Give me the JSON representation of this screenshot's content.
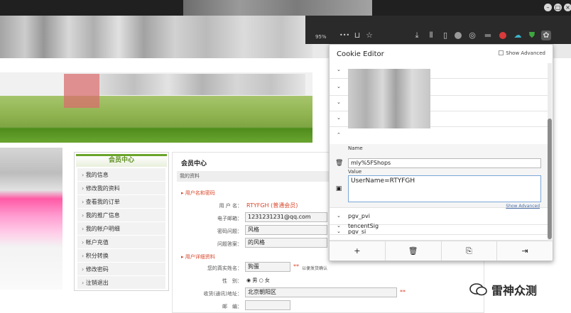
{
  "browser": {
    "zoom": "95%",
    "overflow_label": "•••"
  },
  "member": {
    "header": "会员中心",
    "items": [
      "我的信息",
      "修改我的资料",
      "查看我的订单",
      "我的推广信息",
      "我的帐户明细",
      "帐户充值",
      "积分转换",
      "修改密码",
      "注销退出"
    ]
  },
  "main": {
    "title": "会员中心",
    "bar": "我的资料",
    "section1": "用户名和密码",
    "section2": "用户详细资料",
    "fields": {
      "username_label": "用 户 名：",
      "username_value": "RTYFGH",
      "member_type": "(普通会员)",
      "email_label": "电子邮箱：",
      "email_value": "1231231231@qq.com",
      "question_label": "密码问题：",
      "question_value": "风格",
      "answer_label": "问题答案：",
      "answer_value": "的风格",
      "realname_label": "您的真实姓名：",
      "realname_value": "狗蛋",
      "realname_note": "以便发货确认",
      "gender_label": "性　别：",
      "gender_male": "男",
      "gender_female": "女",
      "address_label": "收货(通讯)地址：",
      "address_value": "北京朝阳区",
      "zip_label": "邮　编："
    },
    "req_mark": "**"
  },
  "cookie_editor": {
    "title": "Cookie Editor",
    "show_advanced": "Show Advanced",
    "name_label": "Name",
    "name_value": "mly%5FShops",
    "value_label": "Value",
    "value_value": "UserName=RTYFGH",
    "show_advanced_link": "Show Advanced",
    "cookies": [
      "pgv_pvi",
      "pgv_si",
      "tencentSig"
    ]
  },
  "watermark": {
    "text": "雷神众测"
  },
  "colors": {
    "accent_green": "#6aa42a",
    "required_red": "#d9472b",
    "popup_border": "#c9c9c9"
  }
}
